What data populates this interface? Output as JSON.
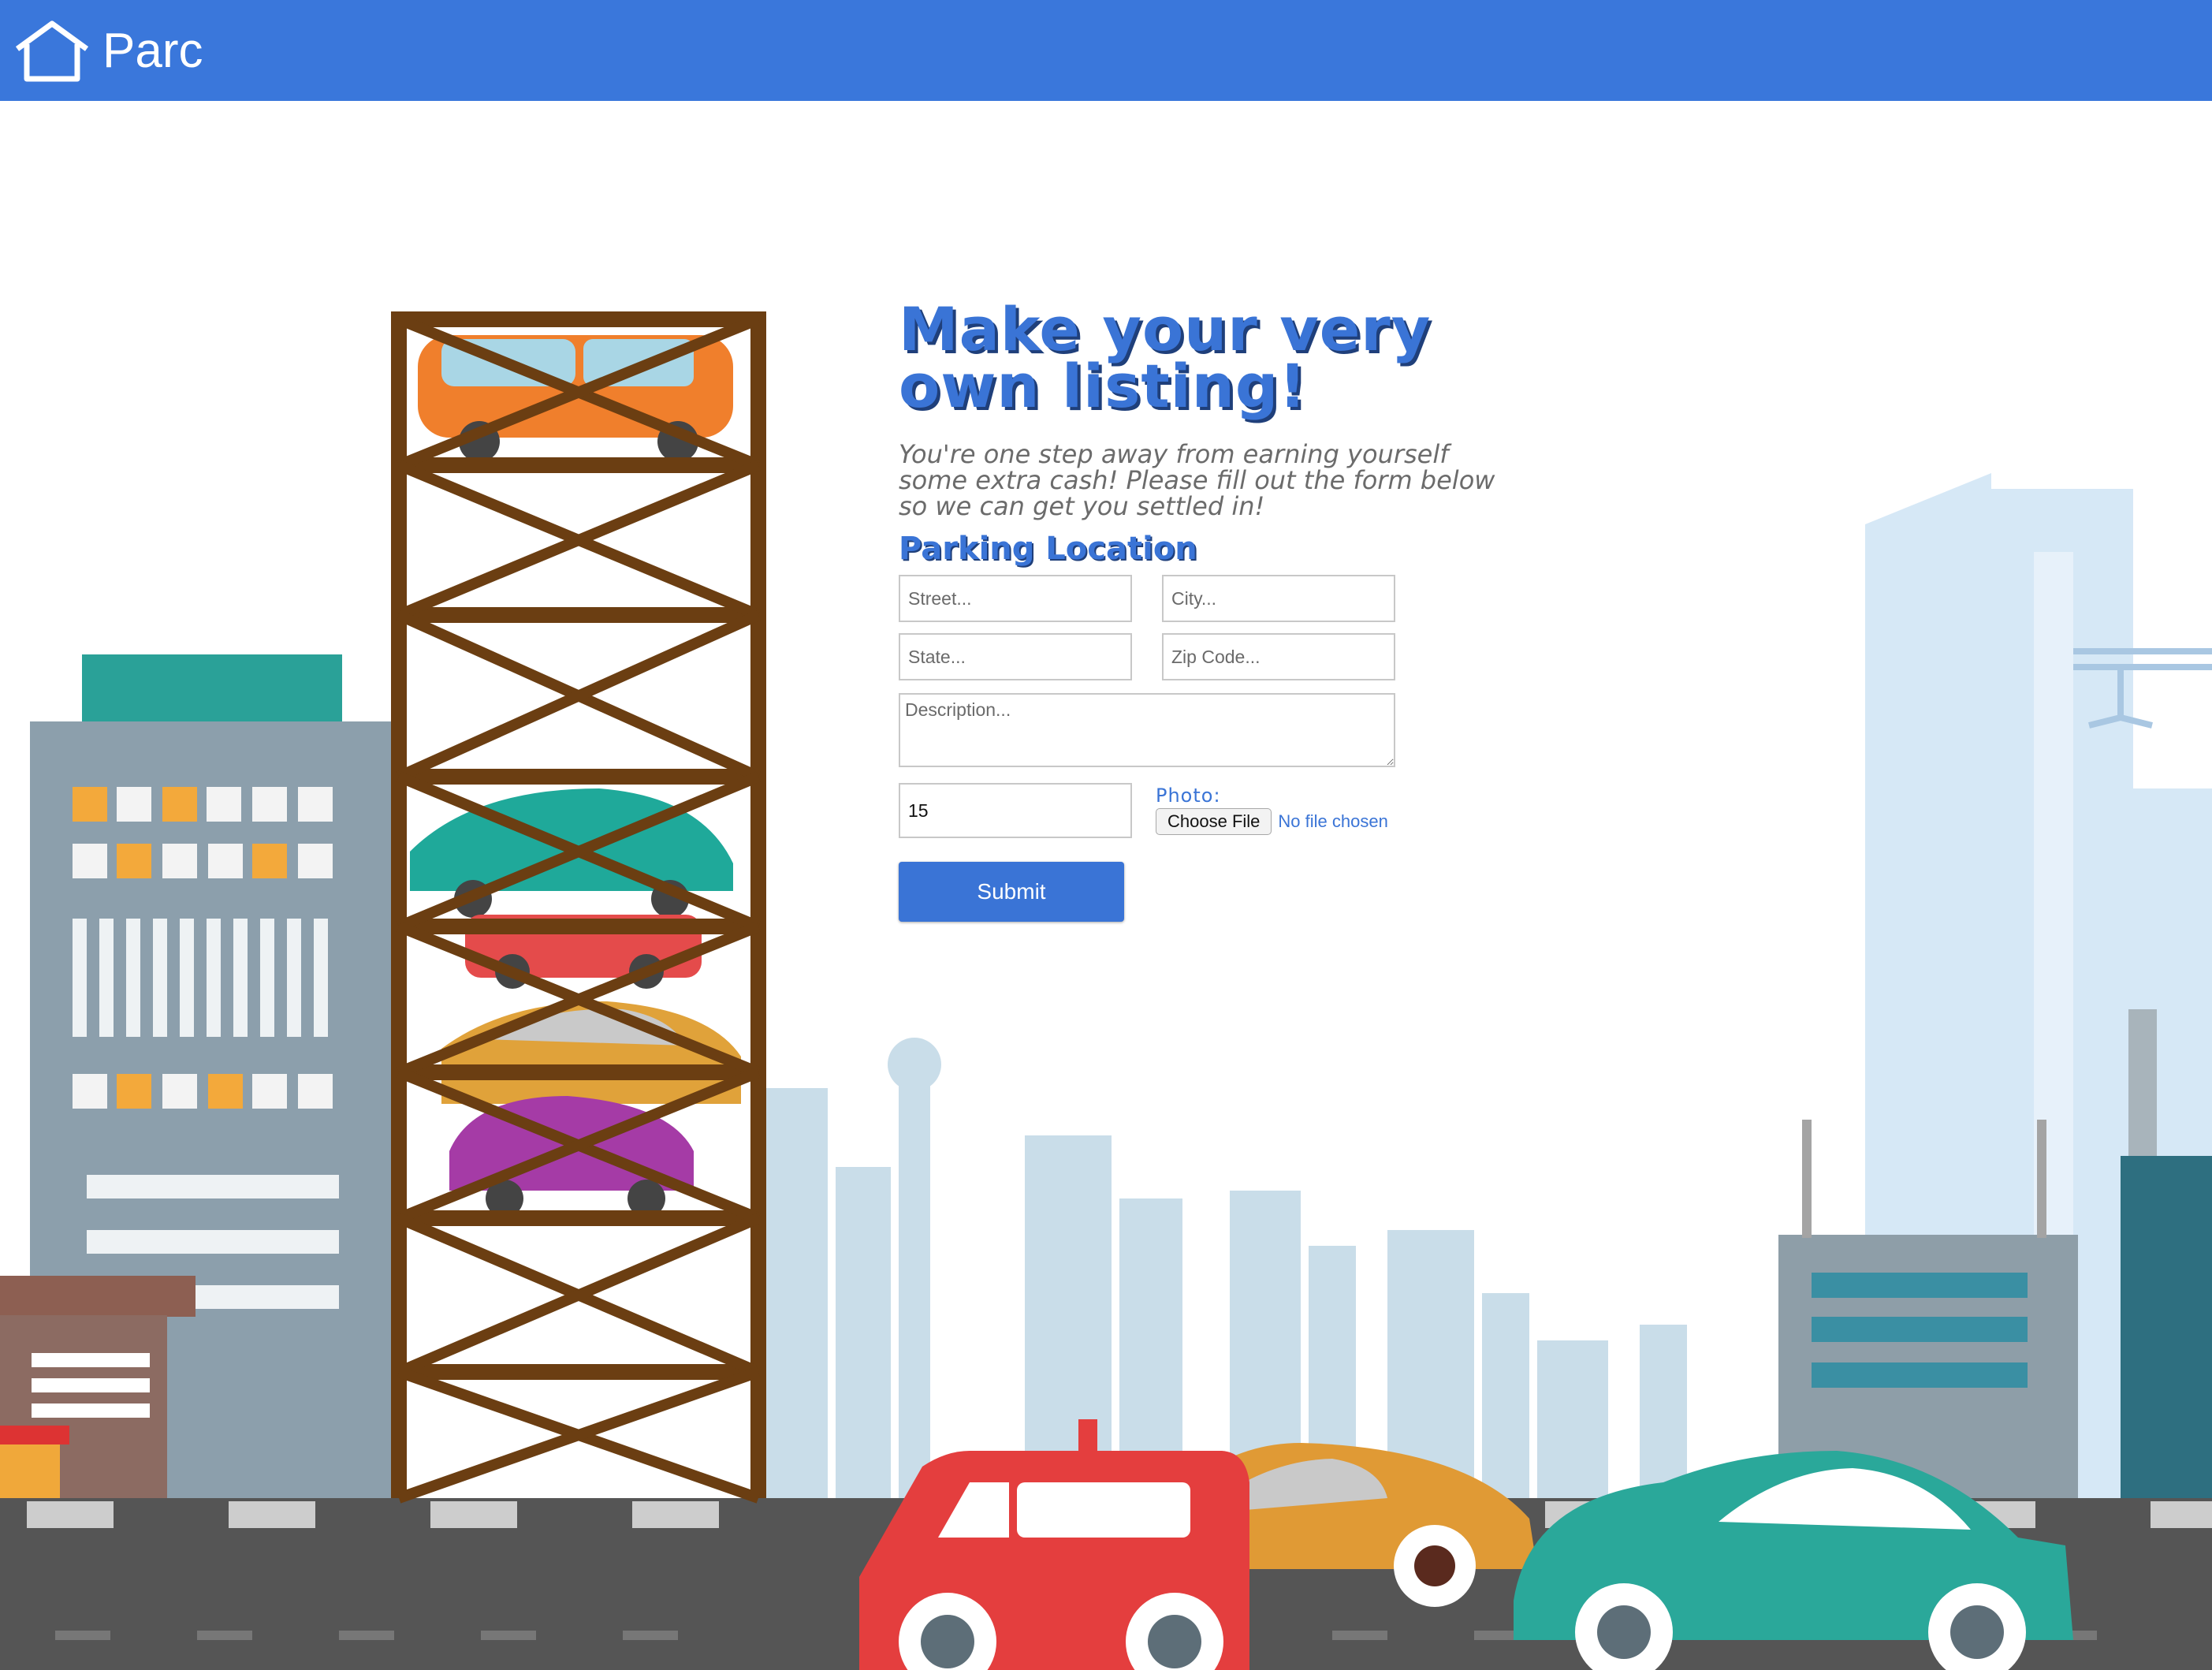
{
  "header": {
    "brand": "Parc",
    "logo_icon": "house-outline-icon",
    "background_color": "#3a77db"
  },
  "form": {
    "heading": "Make your very own listing!",
    "intro": "You're one step away from earning yourself some extra cash! Please fill out the form below so we can get you settled in!",
    "section_title": "Parking Location",
    "street_placeholder": "Street...",
    "city_placeholder": "City...",
    "state_placeholder": "State...",
    "zip_placeholder": "Zip Code...",
    "description_placeholder": "Description...",
    "price_value": "15",
    "photo_label": "Photo:",
    "choose_file_label": "Choose File",
    "file_status": "No file chosen",
    "submit_label": "Submit",
    "accent_color": "#3a74d6"
  },
  "illustration": {
    "subject": "city-parking-tower-scene"
  }
}
